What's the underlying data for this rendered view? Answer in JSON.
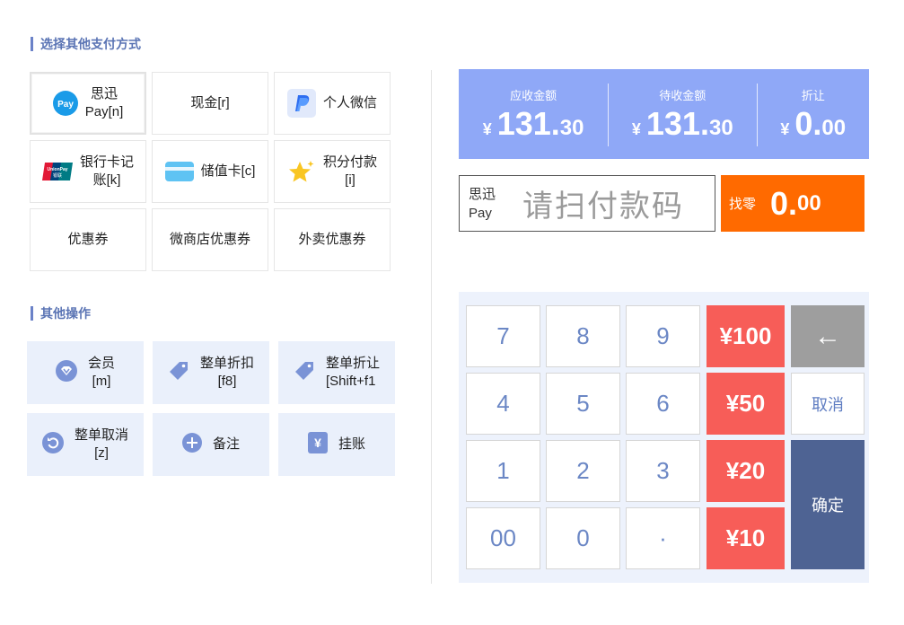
{
  "sections": {
    "other_payment": "选择其他支付方式",
    "other_ops": "其他操作"
  },
  "payment_methods": [
    {
      "label_top": "思迅",
      "label_bottom": "Pay[n]",
      "icon": "pay-icon"
    },
    {
      "label_top": "现金[r]",
      "label_bottom": "",
      "icon": ""
    },
    {
      "label_top": "个人微信",
      "label_bottom": "",
      "icon": "paypal-icon"
    },
    {
      "label_top": "银行卡记",
      "label_bottom": "账[k]",
      "icon": "unionpay-icon"
    },
    {
      "label_top": "储值卡[c]",
      "label_bottom": "",
      "icon": "card-icon"
    },
    {
      "label_top": "积分付款",
      "label_bottom": "[i]",
      "icon": "star-icon"
    },
    {
      "label_top": "优惠券",
      "label_bottom": "",
      "icon": ""
    },
    {
      "label_top": "微商店优惠券",
      "label_bottom": "",
      "icon": ""
    },
    {
      "label_top": "外卖优惠券",
      "label_bottom": "",
      "icon": ""
    }
  ],
  "operations": [
    {
      "label_top": "会员",
      "label_bottom": "[m]",
      "icon": "member-diamond-icon"
    },
    {
      "label_top": "整单折扣",
      "label_bottom": "[f8]",
      "icon": "tag-icon"
    },
    {
      "label_top": "整单折让",
      "label_bottom": "[Shift+f1",
      "icon": "tag-icon"
    },
    {
      "label_top": "整单取消",
      "label_bottom": "[z]",
      "icon": "undo-icon"
    },
    {
      "label_top": "备注",
      "label_bottom": "",
      "icon": "plus-circle-icon"
    },
    {
      "label_top": "挂账",
      "label_bottom": "",
      "icon": "yen-doc-icon"
    }
  ],
  "summary": {
    "receivable": {
      "caption": "应收金额",
      "currency": "¥",
      "int": "131.",
      "dec": "30"
    },
    "pending": {
      "caption": "待收金额",
      "currency": "¥",
      "int": "131.",
      "dec": "30"
    },
    "discount": {
      "caption": "折让",
      "currency": "¥",
      "int": "0.",
      "dec": "00"
    }
  },
  "scan": {
    "brand_line1": "思迅",
    "brand_line2": "Pay",
    "placeholder": "请扫付款码"
  },
  "change": {
    "caption": "找零",
    "int": "0.",
    "dec": "00"
  },
  "keypad": {
    "k7": "7",
    "k8": "8",
    "k9": "9",
    "k4": "4",
    "k5": "5",
    "k6": "6",
    "k1": "1",
    "k2": "2",
    "k3": "3",
    "k00": "00",
    "k0": "0",
    "kdot": "·",
    "q100": "¥100",
    "q50": "¥50",
    "q20": "¥20",
    "q10": "¥10",
    "back": "←",
    "cancel": "取消",
    "confirm": "确定"
  },
  "colors": {
    "accent": "#8fa8f7",
    "change": "#ff6a00",
    "quick_amount": "#f75d58",
    "confirm": "#4e6393",
    "op_tile_bg": "#eaf0fb"
  }
}
